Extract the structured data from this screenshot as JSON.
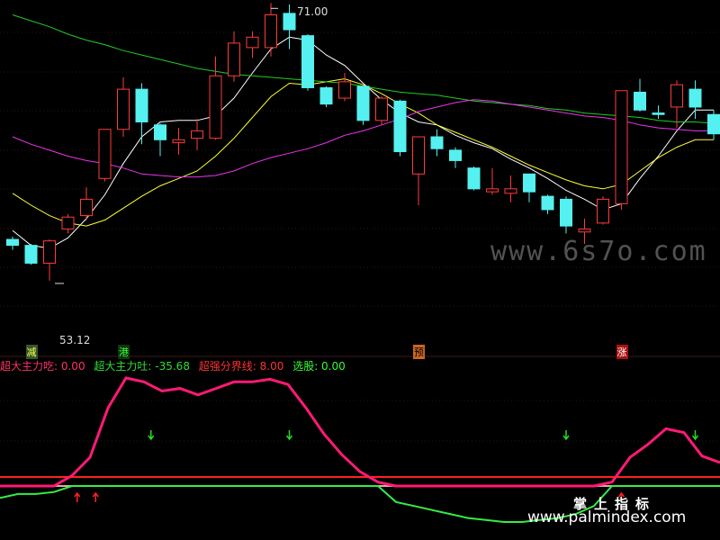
{
  "chart_data": [
    {
      "type": "candlestick",
      "panel": "main",
      "ylim": [
        49,
        72
      ],
      "max_label": "71.00",
      "min_label": "53.12",
      "candles": [
        {
          "o": 55.9,
          "c": 55.5,
          "h": 56.1,
          "l": 55.2
        },
        {
          "o": 55.5,
          "c": 54.3,
          "h": 55.6,
          "l": 54.2
        },
        {
          "o": 54.3,
          "c": 55.8,
          "h": 55.9,
          "l": 53.12
        },
        {
          "o": 56.6,
          "c": 57.4,
          "h": 57.6,
          "l": 56.3
        },
        {
          "o": 57.5,
          "c": 58.6,
          "h": 59.4,
          "l": 57.2
        },
        {
          "o": 60.0,
          "c": 63.3,
          "h": 63.3,
          "l": 59.8
        },
        {
          "o": 63.3,
          "c": 66.0,
          "h": 66.8,
          "l": 62.8
        },
        {
          "o": 66.0,
          "c": 63.8,
          "h": 66.4,
          "l": 62.3
        },
        {
          "o": 63.6,
          "c": 62.6,
          "h": 63.7,
          "l": 61.5
        },
        {
          "o": 62.4,
          "c": 62.6,
          "h": 63.4,
          "l": 61.6
        },
        {
          "o": 62.7,
          "c": 63.2,
          "h": 64.0,
          "l": 61.9
        },
        {
          "o": 62.7,
          "c": 66.9,
          "h": 68.2,
          "l": 62.6
        },
        {
          "o": 66.9,
          "c": 69.1,
          "h": 69.9,
          "l": 66.5
        },
        {
          "o": 68.8,
          "c": 69.5,
          "h": 69.9,
          "l": 68.1
        },
        {
          "o": 68.8,
          "c": 71.0,
          "h": 71.8,
          "l": 68.2
        },
        {
          "o": 71.1,
          "c": 70.0,
          "h": 71.7,
          "l": 68.7
        },
        {
          "o": 69.6,
          "c": 66.1,
          "h": 69.7,
          "l": 65.9
        },
        {
          "o": 66.1,
          "c": 65.0,
          "h": 66.2,
          "l": 64.8
        },
        {
          "o": 65.4,
          "c": 66.5,
          "h": 67.1,
          "l": 65.2
        },
        {
          "o": 66.2,
          "c": 63.9,
          "h": 66.2,
          "l": 63.6
        },
        {
          "o": 63.9,
          "c": 65.4,
          "h": 65.5,
          "l": 63.6
        },
        {
          "o": 65.2,
          "c": 61.8,
          "h": 65.3,
          "l": 61.5
        },
        {
          "o": 60.3,
          "c": 62.8,
          "h": 62.8,
          "l": 58.2
        },
        {
          "o": 62.8,
          "c": 62.0,
          "h": 63.3,
          "l": 61.5
        },
        {
          "o": 61.9,
          "c": 61.2,
          "h": 62.1,
          "l": 60.7
        },
        {
          "o": 60.7,
          "c": 59.3,
          "h": 60.8,
          "l": 59.2
        },
        {
          "o": 59.1,
          "c": 59.3,
          "h": 60.7,
          "l": 58.9
        },
        {
          "o": 59.0,
          "c": 59.3,
          "h": 60.2,
          "l": 58.4
        },
        {
          "o": 60.3,
          "c": 59.1,
          "h": 60.3,
          "l": 58.4
        },
        {
          "o": 58.8,
          "c": 57.9,
          "h": 58.9,
          "l": 57.6
        },
        {
          "o": 58.6,
          "c": 56.8,
          "h": 58.8,
          "l": 56.3
        },
        {
          "o": 56.4,
          "c": 56.6,
          "h": 57.3,
          "l": 55.6
        },
        {
          "o": 57.0,
          "c": 58.6,
          "h": 58.8,
          "l": 56.9
        },
        {
          "o": 58.3,
          "c": 65.9,
          "h": 65.9,
          "l": 57.9
        },
        {
          "o": 65.8,
          "c": 64.6,
          "h": 66.7,
          "l": 64.5
        },
        {
          "o": 64.4,
          "c": 64.3,
          "h": 64.9,
          "l": 64.0
        },
        {
          "o": 64.8,
          "c": 66.3,
          "h": 66.6,
          "l": 63.4
        },
        {
          "o": 66.0,
          "c": 64.8,
          "h": 66.6,
          "l": 64.0
        },
        {
          "o": 64.3,
          "c": 63.0,
          "h": 64.6,
          "l": 62.6
        }
      ],
      "series": [
        {
          "color": "#ffffff",
          "values": [
            56.5,
            55.5,
            55.3,
            56.0,
            57.3,
            58.9,
            61.0,
            62.8,
            63.8,
            63.9,
            63.9,
            64.2,
            65.4,
            67.1,
            68.7,
            69.5,
            69.3,
            68.3,
            67.6,
            66.4,
            65.3,
            64.4,
            63.8,
            63.6,
            62.9,
            62.4,
            62.0,
            61.3,
            60.7,
            60.0,
            59.2,
            58.6,
            57.9,
            58.3,
            60.0,
            61.5,
            63.2,
            64.6,
            64.6
          ]
        },
        {
          "color": "#ffff33",
          "values": [
            59.0,
            58.2,
            57.5,
            57.0,
            56.8,
            57.2,
            58.0,
            58.8,
            59.5,
            60.0,
            60.5,
            61.5,
            62.7,
            64.1,
            65.5,
            66.4,
            66.3,
            66.5,
            66.7,
            66.3,
            65.7,
            65.0,
            64.4,
            63.6,
            63.1,
            62.6,
            62.1,
            61.5,
            60.9,
            60.4,
            59.9,
            59.5,
            59.3,
            59.6,
            60.5,
            61.4,
            62.1,
            62.6,
            62.6
          ]
        },
        {
          "color": "#22cc22",
          "values": [
            71.0,
            70.6,
            70.2,
            69.7,
            69.3,
            69.0,
            68.6,
            68.3,
            68.0,
            67.7,
            67.4,
            67.2,
            67.0,
            66.9,
            66.8,
            66.7,
            66.6,
            66.5,
            66.4,
            66.2,
            66.0,
            65.8,
            65.7,
            65.6,
            65.4,
            65.2,
            65.1,
            65.0,
            64.9,
            64.7,
            64.6,
            64.4,
            64.3,
            64.2,
            64.1,
            63.9,
            63.8,
            63.8,
            63.7
          ]
        },
        {
          "color": "#ee33ee",
          "values": [
            62.8,
            62.3,
            61.9,
            61.5,
            61.2,
            61.0,
            60.7,
            60.3,
            60.2,
            60.1,
            60.1,
            60.2,
            60.5,
            61.0,
            61.4,
            61.7,
            62.0,
            62.4,
            62.9,
            63.2,
            63.6,
            64.0,
            64.5,
            64.8,
            65.1,
            65.3,
            65.2,
            65.0,
            64.8,
            64.6,
            64.4,
            64.2,
            64.1,
            63.9,
            63.6,
            63.4,
            63.3,
            63.2,
            63.2
          ]
        }
      ],
      "signals": [
        {
          "index": 1,
          "text": "减",
          "bg": "#335533",
          "fg": "#ffff44"
        },
        {
          "index": 6,
          "text": "港",
          "bg": "#113311",
          "fg": "#33ff33"
        },
        {
          "index": 22,
          "text": "预",
          "bg": "#cc6622",
          "fg": "#000000"
        },
        {
          "index": 33,
          "text": "涨",
          "bg": "#aa1111",
          "fg": "#ffffff"
        }
      ]
    },
    {
      "type": "line",
      "panel": "indicator",
      "ylim": [
        -36.2,
        10
      ],
      "legend": [
        {
          "text": "超大主力吃: 0.00",
          "color": "#ff3366"
        },
        {
          "text": "超大主力吐: -35.68",
          "color": "#33dd33"
        },
        {
          "text": "超强分界线: 8.00",
          "color": "#ff3333"
        },
        {
          "text": "选股: 0.00",
          "color": "#33ff33"
        }
      ],
      "hline_value": 8.0,
      "chi": {
        "color": "#ff1a75",
        "values": [
          0,
          0,
          0,
          0,
          8,
          22,
          60,
          83,
          80,
          73,
          75,
          70,
          75,
          80,
          80,
          82,
          78,
          60,
          40,
          24,
          11,
          3,
          0,
          0,
          0,
          0,
          0,
          0,
          0,
          0,
          0,
          0,
          0,
          0,
          3,
          22,
          32,
          44,
          41,
          23,
          18
        ]
      },
      "tu": {
        "color": "#33ee44",
        "values": [
          -6,
          -4,
          -4,
          -3,
          0,
          0,
          0,
          0,
          0,
          0,
          0,
          0,
          0,
          0,
          0,
          0,
          0,
          0,
          0,
          0,
          0,
          0,
          -8,
          -10,
          -12,
          -14,
          -16,
          -17,
          -18,
          -18,
          -17,
          -16,
          -14,
          -10,
          0,
          0,
          0,
          0,
          0,
          0,
          0
        ]
      },
      "down_arrows": [
        7.5,
        15.0,
        30.0,
        37.0
      ],
      "up_arrows": [
        3.5,
        4.5,
        33.0
      ]
    }
  ],
  "watermarks": {
    "main": "www.6s7o.com",
    "cn": "掌上指标",
    "url": "www.palmindex.com"
  }
}
